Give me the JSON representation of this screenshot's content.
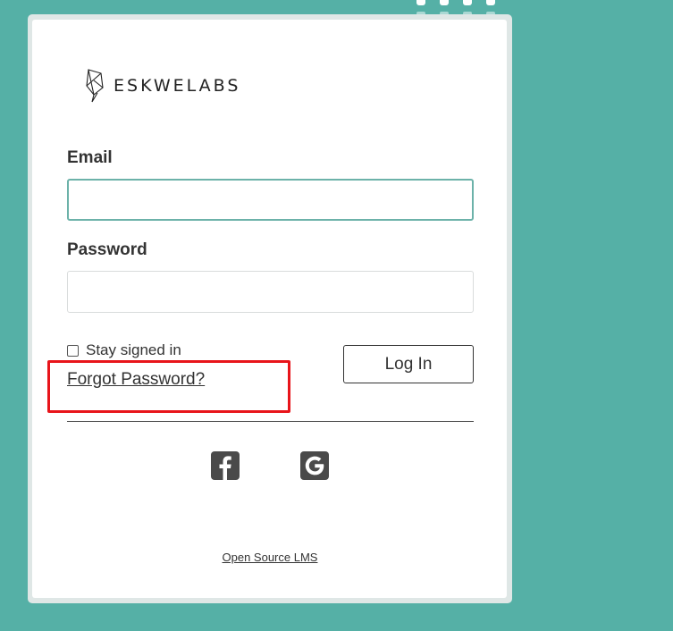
{
  "brand": {
    "name": "ESKWELABS"
  },
  "form": {
    "email_label": "Email",
    "email_value": "",
    "email_placeholder": "",
    "password_label": "Password",
    "password_value": "",
    "password_placeholder": "",
    "stay_signed_in_label": "Stay signed in",
    "stay_signed_in_checked": false,
    "forgot_password_label": "Forgot Password?",
    "login_button_label": "Log In"
  },
  "social": {
    "facebook_icon": "facebook-icon",
    "google_icon": "google-icon"
  },
  "footer": {
    "link_label": "Open Source LMS"
  },
  "colors": {
    "background": "#55b0a6",
    "focus_border": "#6cb2a9",
    "highlight": "#e8141a",
    "icon": "#4a4a4a"
  }
}
